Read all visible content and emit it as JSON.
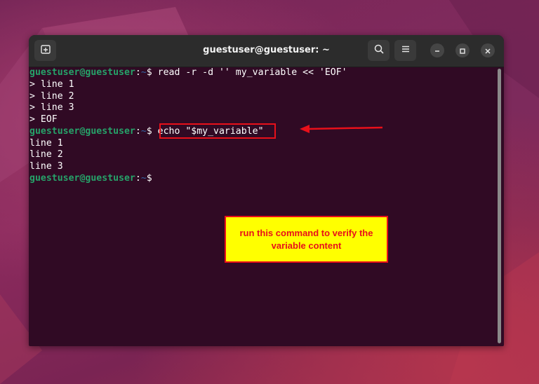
{
  "window": {
    "title": "guestuser@guestuser: ~"
  },
  "terminal": {
    "lines": [
      {
        "user": "guestuser@guestuser",
        "sep": ":",
        "path": "~",
        "sym": "$ ",
        "text": "read -r -d '' my_variable << 'EOF'"
      },
      {
        "text": "> line 1"
      },
      {
        "text": "> line 2"
      },
      {
        "text": "> line 3"
      },
      {
        "text": "> EOF"
      },
      {
        "user": "guestuser@guestuser",
        "sep": ":",
        "path": "~",
        "sym": "$ ",
        "text": "echo \"$my_variable\""
      },
      {
        "text": "line 1"
      },
      {
        "text": "line 2"
      },
      {
        "text": "line 3"
      },
      {
        "user": "guestuser@guestuser",
        "sep": ":",
        "path": "~",
        "sym": "$",
        "text": ""
      }
    ]
  },
  "annotation": {
    "text": "run this command to verify the variable content",
    "color": "#e8101a",
    "background": "#ffff00"
  },
  "icons": {
    "new_tab": "new-tab-icon",
    "search": "search-icon",
    "menu": "hamburger-menu-icon",
    "minimize": "minimize-icon",
    "maximize": "maximize-icon",
    "close": "close-icon"
  },
  "colors": {
    "terminal_bg": "#300a24",
    "prompt_user": "#26a269",
    "prompt_path": "#3465a4",
    "titlebar": "#2c2c2c"
  }
}
